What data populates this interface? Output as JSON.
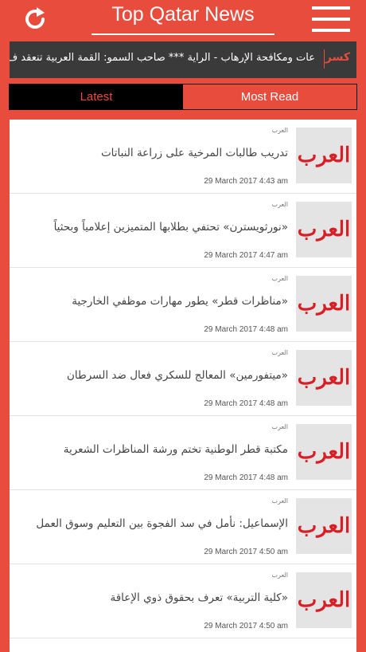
{
  "header": {
    "title": "Top Qatar News",
    "refresh_icon": "refresh-icon",
    "menu_icon": "hamburger-menu-icon"
  },
  "ticker": {
    "label": "كسر",
    "text": "عات ومكافحة الإرهاب - الراية *** صاحب السمو: القمة العربية تنعقد ف"
  },
  "tabs": [
    {
      "label": "Latest",
      "active": true
    },
    {
      "label": "Most Read",
      "active": false
    }
  ],
  "articles": [
    {
      "source": "العرب",
      "headline": "تدريب طالبات المرخية على زراعة النباتات",
      "date": "29 March 2017 4:43 am",
      "thumb": "العرب"
    },
    {
      "source": "العرب",
      "headline": "«نورثويسترن» تحتفي بطلابها المتميزين إعلامياً وبحثياً",
      "date": "29 March 2017 4:47 am",
      "thumb": "العرب"
    },
    {
      "source": "العرب",
      "headline": "«مناظرات قطر» يطور مهارات موظفي الخارجية",
      "date": "29 March 2017 4:48 am",
      "thumb": "العرب"
    },
    {
      "source": "العرب",
      "headline": "«ميتفورمين» المعالج للسكري فعال ضد السرطان",
      "date": "29 March 2017 4:48 am",
      "thumb": "العرب"
    },
    {
      "source": "العرب",
      "headline": "مكتبة قطر  الوطنية تختم ورشة المناظرات الشعرية",
      "date": "29 March 2017 4:48 am",
      "thumb": "العرب"
    },
    {
      "source": "العرب",
      "headline": "الإسماعيل: نأمل في سد الفجوة بين التعليم وسوق العمل",
      "date": "29 March 2017 4:50 am",
      "thumb": "العرب"
    },
    {
      "source": "العرب",
      "headline": "«كلية التربية» تعرف بحقوق ذوي الإعاقة",
      "date": "29 March 2017 4:50 am",
      "thumb": "العرب"
    }
  ],
  "colors": {
    "accent": "#e84c3d",
    "ticker_bg": "#3a3a3a",
    "tab_active_bg": "#000000"
  }
}
